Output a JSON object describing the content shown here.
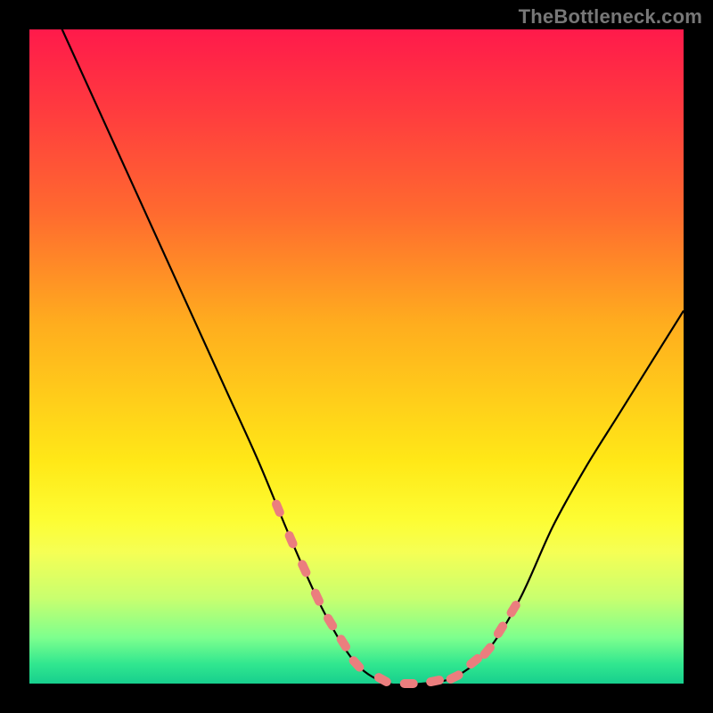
{
  "watermark": "TheBottleneck.com",
  "colors": {
    "frame": "#000000",
    "gradient_top": "#ff1a4b",
    "gradient_bottom": "#17cf8e",
    "curve": "#000000",
    "marker": "#eb7e7e"
  },
  "chart_data": {
    "type": "line",
    "title": "",
    "xlabel": "",
    "ylabel": "",
    "xlim": [
      0,
      100
    ],
    "ylim": [
      0,
      100
    ],
    "x": [
      0,
      5,
      10,
      15,
      20,
      25,
      30,
      35,
      40,
      45,
      50,
      55,
      60,
      65,
      70,
      75,
      80,
      85,
      90,
      95,
      100
    ],
    "values": [
      120,
      100,
      89,
      78,
      67,
      56,
      45,
      34,
      22,
      11,
      3,
      0,
      0,
      1,
      5,
      13,
      24,
      33,
      41,
      49,
      57
    ],
    "note": "Values estimated from pixel heights; y=0 is the bottom green band, y≈100 is near the top of the plot. Left branch reaches ~100 at the top edge; right branch rises to ~57 at the right edge; minimum is a narrow flat 0 near x≈55–62.",
    "markers_x": [
      38,
      40,
      42,
      44,
      46,
      48,
      50,
      54,
      58,
      62,
      65,
      68,
      70,
      72,
      74
    ]
  }
}
